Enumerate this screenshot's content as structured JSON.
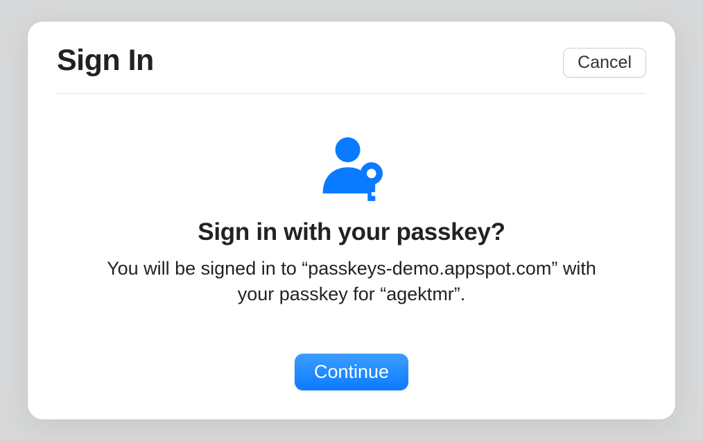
{
  "dialog": {
    "title": "Sign In",
    "cancel_label": "Cancel"
  },
  "prompt": {
    "title": "Sign in with your passkey?",
    "description": "You will be signed in to “passkeys-demo.appspot.com” with your passkey for “agektmr”.",
    "continue_label": "Continue"
  },
  "site": "passkeys-demo.appspot.com",
  "account": "agektmr",
  "colors": {
    "accent": "#0a7bff",
    "icon": "#0a7bff"
  }
}
